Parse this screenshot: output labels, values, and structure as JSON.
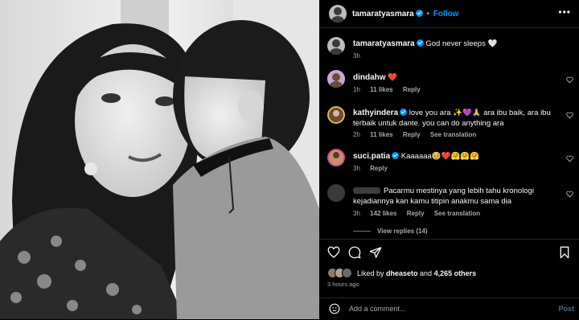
{
  "post": {
    "author": "tamaratyasmara",
    "follow_label": "Follow",
    "more_label": "•••",
    "caption": "God never sleeps 🤍",
    "caption_time": "3h"
  },
  "comments": [
    {
      "user": "dindahw",
      "text": "❤️",
      "time": "1h",
      "likes": "11 likes",
      "reply": "Reply",
      "translation": ""
    },
    {
      "user": "kathyindera",
      "text": "love you ara ✨💜🙏 ara ibu baik, ara ibu terbaik untuk dante. you can do anything ara",
      "time": "2h",
      "likes": "11 likes",
      "reply": "Reply",
      "translation": "See translation"
    },
    {
      "user": "suci.patia",
      "text": "Kaaaaaa🥹❤️🤗🤗🤗",
      "time": "3h",
      "likes": "",
      "reply": "Reply",
      "translation": ""
    },
    {
      "user": "",
      "text": "Pacarmu mestinya yang lebih tahu kronologi kejadiannya kan kamu titipin anakmu sama dia",
      "time": "3h",
      "likes": "142 likes",
      "reply": "Reply",
      "translation": "See translation"
    }
  ],
  "view_replies": "View replies (14)",
  "likes": {
    "prefix": "Liked by ",
    "user": "dheaseto",
    "mid": " and ",
    "count": "4,265 others"
  },
  "time_ago": "3 hours ago",
  "add_comment": {
    "placeholder": "Add a comment...",
    "post_label": "Post"
  },
  "colors": {
    "accent": "#0095f6",
    "background": "#000000",
    "muted": "#a8a8a8",
    "heart_red": "#ed4956"
  },
  "icons": [
    "verified-badge-icon",
    "more-icon",
    "heart-icon",
    "comment-icon",
    "share-icon",
    "bookmark-icon",
    "emoji-icon"
  ]
}
